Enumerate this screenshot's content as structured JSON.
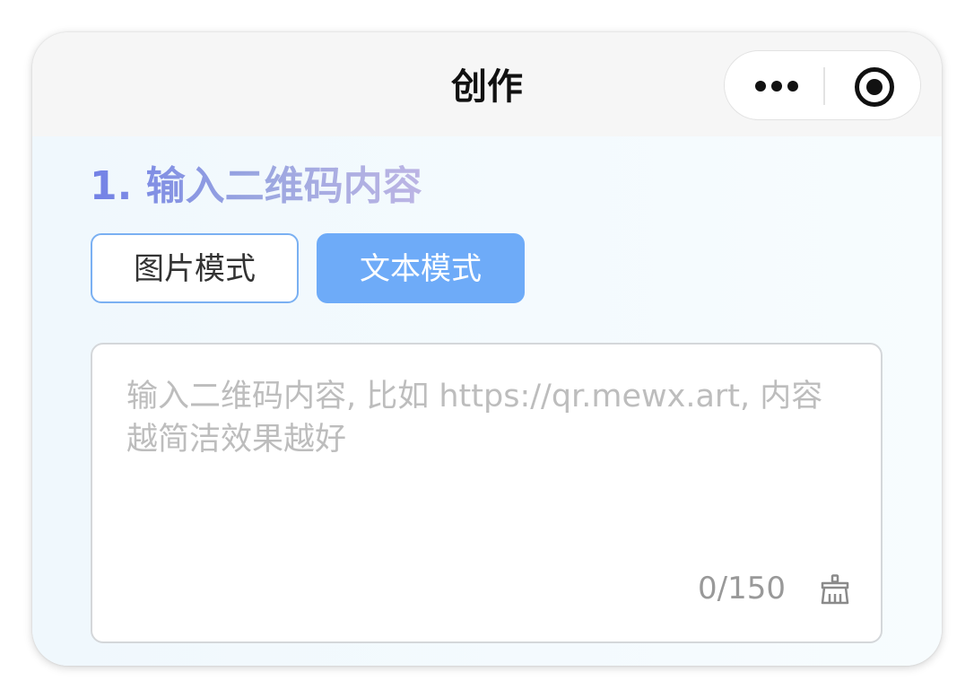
{
  "navbar": {
    "title": "创作",
    "more_icon": "more-dots-icon",
    "close_icon": "target-circle-icon"
  },
  "section": {
    "title": "1. 输入二维码内容"
  },
  "modes": {
    "image_label": "图片模式",
    "text_label": "文本模式",
    "selected": "文本模式"
  },
  "input": {
    "value": "",
    "placeholder": "输入二维码内容, 比如 https://qr.mewx.art, 内容越简洁效果越好",
    "counter": "0/150",
    "clear_icon": "broom-icon"
  },
  "colors": {
    "accent": "#6eabf8",
    "title_gradient_start": "#7281e6",
    "title_gradient_end": "#bcb5e4"
  }
}
